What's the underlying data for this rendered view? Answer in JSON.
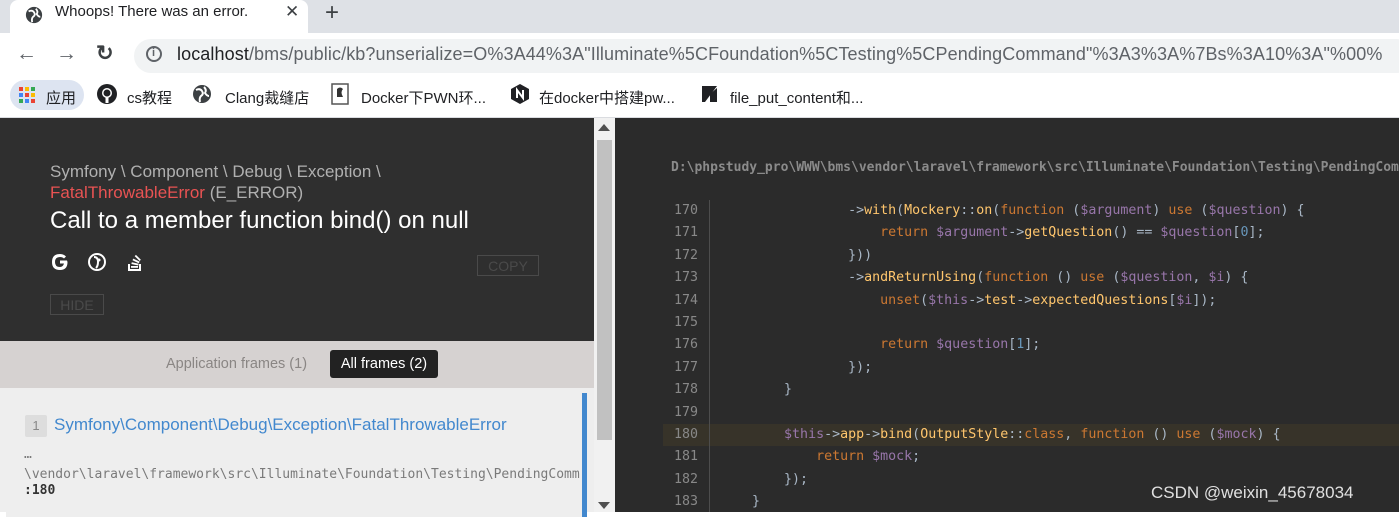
{
  "browser": {
    "tab": {
      "title": "Whoops! There was an error.",
      "close": "✕",
      "new_tab": "+"
    },
    "nav": {
      "back": "←",
      "forward": "→",
      "reload": "↻"
    },
    "url": {
      "host": "localhost",
      "path": "/bms/public/kb?unserialize=O%3A44%3A\"Illuminate%5CFoundation%5CTesting%5CPendingCommand\"%3A3%3A%7Bs%3A10%3A\"%00%"
    },
    "bookmarks": [
      {
        "label": "应用",
        "icon": "apps-grid-icon"
      },
      {
        "label": "cs教程",
        "icon": "github-icon"
      },
      {
        "label": "Clang裁缝店",
        "icon": "globe-icon"
      },
      {
        "label": "Docker下PWN环...",
        "icon": "docker-doc-icon"
      },
      {
        "label": "在docker中搭建pw...",
        "icon": "n-logo-icon"
      },
      {
        "label": "file_put_content和...",
        "icon": "zhihu-logo-icon"
      }
    ]
  },
  "error": {
    "breadcrumb": "Symfony \\ Component \\ Debug \\ Exception \\",
    "type": "FatalThrowableError",
    "level": "(E_ERROR)",
    "message": "Call to a member function bind() on null",
    "copy_label": "COPY",
    "hide_label": "HIDE",
    "icons": [
      "google-icon",
      "duckduckgo-icon",
      "stackoverflow-icon"
    ]
  },
  "frames": {
    "app_frames": "Application frames (1)",
    "all_frames": "All frames (2)",
    "items": [
      {
        "num": "1",
        "class": "Symfony\\Component\\Debug\\Exception\\FatalThrowableError",
        "path": "…\n\\vendor\\laravel\\framework\\src\\Illuminate\\Foundation\\Testing\\PendingCommand.php",
        "line": ":180"
      }
    ]
  },
  "code": {
    "file": "D:\\phpstudy_pro\\WWW\\bms\\vendor\\laravel\\framework\\src\\Illuminate\\Foundation\\Testing\\PendingCommand.php",
    "highlighted_line": 180,
    "line_numbers": [
      "170",
      "171",
      "172",
      "173",
      "174",
      "175",
      "176",
      "177",
      "178",
      "179",
      "180",
      "181",
      "182",
      "183"
    ]
  },
  "watermark": "CSDN @weixin_45678034",
  "colors": {
    "accent_blue": "#4288ce",
    "error_red": "#e95353",
    "code_bg": "#2b2b2b"
  }
}
